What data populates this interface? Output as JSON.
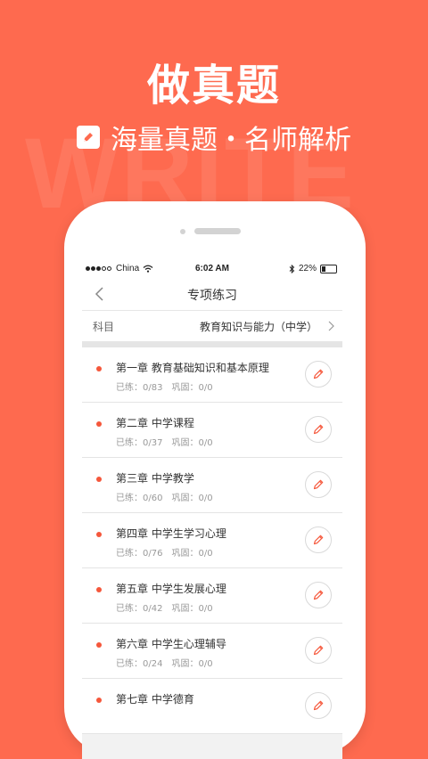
{
  "colors": {
    "background": "#fe6a4f",
    "accent": "#f5573b"
  },
  "promo": {
    "headline": "做真题",
    "subline": "海量真题・名师解析",
    "watermark": "WRITE"
  },
  "statusbar": {
    "carrier": "China",
    "time": "6:02 AM",
    "battery": "22%"
  },
  "navbar": {
    "title": "专项练习",
    "back_icon": "chevron-left-icon"
  },
  "subject": {
    "label": "科目",
    "value": "教育知识与能力（中学）"
  },
  "chapters": [
    {
      "title": "第一章  教育基础知识和基本原理",
      "done": "已练：0/83",
      "review": "巩固：0/0"
    },
    {
      "title": "第二章  中学课程",
      "done": "已练：0/37",
      "review": "巩固：0/0"
    },
    {
      "title": "第三章  中学教学",
      "done": "已练：0/60",
      "review": "巩固：0/0"
    },
    {
      "title": "第四章  中学生学习心理",
      "done": "已练：0/76",
      "review": "巩固：0/0"
    },
    {
      "title": "第五章  中学生发展心理",
      "done": "已练：0/42",
      "review": "巩固：0/0"
    },
    {
      "title": "第六章  中学生心理辅导",
      "done": "已练：0/24",
      "review": "巩固：0/0"
    },
    {
      "title": "第七章  中学德育",
      "done": "",
      "review": ""
    }
  ]
}
